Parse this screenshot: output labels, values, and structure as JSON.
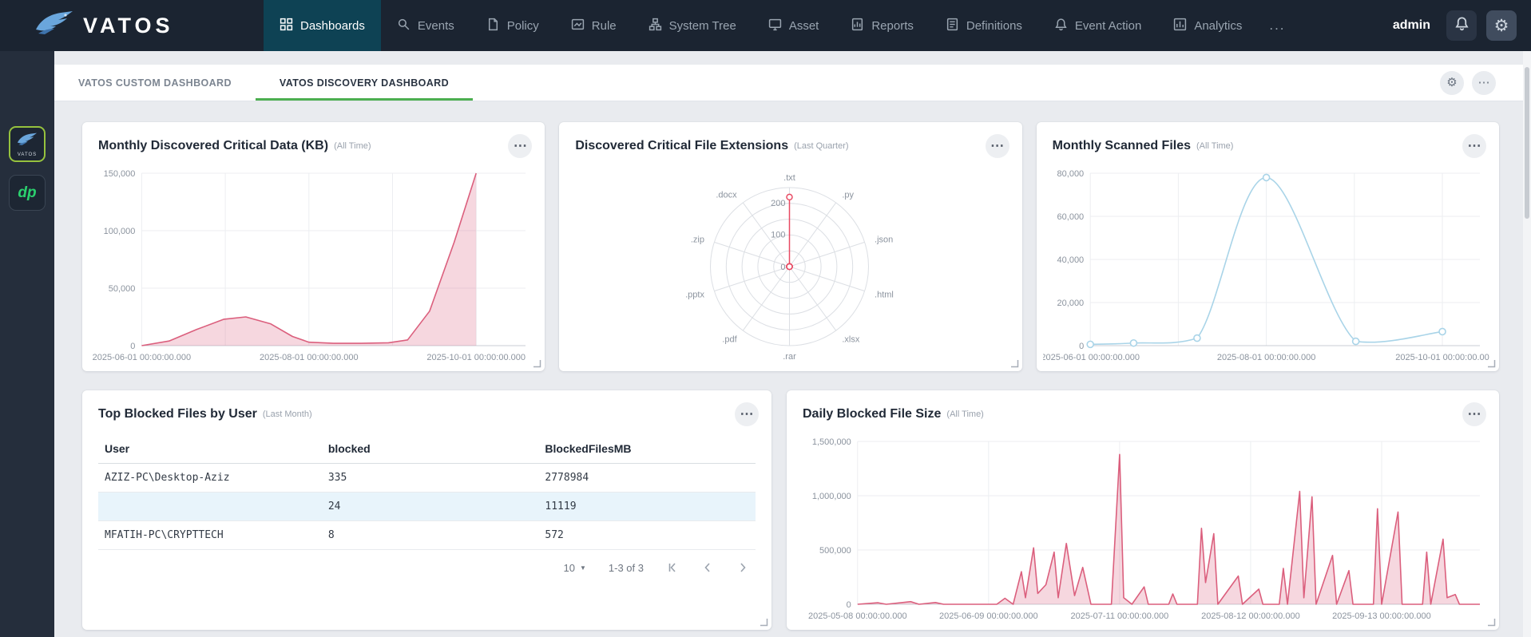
{
  "topbar": {
    "user": "admin"
  },
  "brand": {
    "name": "VATOS"
  },
  "icons": {
    "gear": "⚙",
    "more": "⋯",
    "caret": "▼"
  },
  "nav": {
    "items": [
      {
        "label": "Dashboards"
      },
      {
        "label": "Events"
      },
      {
        "label": "Policy"
      },
      {
        "label": "Rule"
      },
      {
        "label": "System Tree"
      },
      {
        "label": "Asset"
      },
      {
        "label": "Reports"
      },
      {
        "label": "Definitions"
      },
      {
        "label": "Event Action"
      },
      {
        "label": "Analytics"
      },
      {
        "label": "..."
      }
    ]
  },
  "sidebar": {
    "items": [
      {
        "name": "vatos-app",
        "text": "VATOS"
      },
      {
        "name": "cryptech-app",
        "text": "dp"
      }
    ]
  },
  "tabs": [
    {
      "label": "VATOS CUSTOM DASHBOARD",
      "active": false
    },
    {
      "label": "VATOS DISCOVERY DASHBOARD",
      "active": true
    }
  ],
  "cards": {
    "critical_data": {
      "title": "Monthly Discovered Critical Data (KB)",
      "subtitle": "(All Time)"
    },
    "extensions": {
      "title": "Discovered Critical File Extensions",
      "subtitle": "(Last Quarter)"
    },
    "scanned": {
      "title": "Monthly Scanned Files",
      "subtitle": "(All Time)"
    },
    "top_blocked": {
      "title": "Top Blocked Files by User",
      "subtitle": "(Last Month)",
      "columns": [
        "User",
        "blocked",
        "BlockedFilesMB"
      ],
      "rows": [
        {
          "user": "AZIZ-PC\\Desktop-Aziz",
          "blocked": "335",
          "mb": "2778984"
        },
        {
          "user": "",
          "blocked": "24",
          "mb": "11119"
        },
        {
          "user": "MFATIH-PC\\CRYPTTECH",
          "blocked": "8",
          "mb": "572"
        }
      ],
      "pagination": {
        "page_size": "10",
        "range": "1-3 of 3"
      }
    },
    "daily_blocked": {
      "title": "Daily Blocked File Size",
      "subtitle": "(All Time)"
    }
  },
  "chart_data": [
    {
      "id": "critical-data",
      "type": "area",
      "title": "Monthly Discovered Critical Data (KB)",
      "period": "All Time",
      "x_domain": [
        0,
        140
      ],
      "x_grid": [
        0,
        30.5,
        61,
        91.5,
        122
      ],
      "x_ticks": [
        {
          "d": 0,
          "label": "2025-06-01 00:00:00.000"
        },
        {
          "d": 61,
          "label": "2025-08-01 00:00:00.000"
        },
        {
          "d": 122,
          "label": "2025-10-01 00:00:00.000"
        }
      ],
      "y_ticks": [
        0,
        50000,
        100000,
        150000
      ],
      "y_max": 150000,
      "line_color": "#db5f7d",
      "fill_color": "rgba(224,112,139,0.28)",
      "smooth": false,
      "markers": false,
      "points": [
        [
          0,
          0
        ],
        [
          10,
          4000
        ],
        [
          20,
          14000
        ],
        [
          30,
          23000
        ],
        [
          38,
          25000
        ],
        [
          47,
          19000
        ],
        [
          55,
          8000
        ],
        [
          61,
          3000
        ],
        [
          70,
          2000
        ],
        [
          80,
          2000
        ],
        [
          90,
          2500
        ],
        [
          97,
          5000
        ],
        [
          105,
          30000
        ],
        [
          114,
          90000
        ],
        [
          122,
          150000
        ]
      ]
    },
    {
      "id": "extensions",
      "type": "radar",
      "title": "Discovered Critical File Extensions",
      "period": "Last Quarter",
      "labels": [
        ".txt",
        ".py",
        ".json",
        ".html",
        ".xlsx",
        ".rar",
        ".pdf",
        ".pptx",
        ".zip",
        ".docx"
      ],
      "values": [
        220,
        0,
        0,
        0,
        0,
        0,
        0,
        0,
        0,
        0
      ],
      "max": 250,
      "rings": [
        50,
        100,
        150,
        200,
        250
      ],
      "ring_labels": [
        0,
        100,
        200
      ],
      "line_color": "#e84a63",
      "fill_color": "rgba(232,74,99,0.15)"
    },
    {
      "id": "scanned",
      "type": "line",
      "title": "Monthly Scanned Files",
      "period": "All Time",
      "x_domain": [
        0,
        135
      ],
      "x_grid": [
        0,
        30.5,
        61,
        91.5,
        122
      ],
      "x_ticks": [
        {
          "d": 0,
          "label": "2025-06-01 00:00:00.000"
        },
        {
          "d": 61,
          "label": "2025-08-01 00:00:00.000"
        },
        {
          "d": 122,
          "label": "2025-10-01 00:00:00.00"
        }
      ],
      "y_ticks": [
        0,
        20000,
        40000,
        60000,
        80000
      ],
      "y_max": 80000,
      "line_color": "#a9d4e8",
      "fill_color": null,
      "smooth": true,
      "markers": true,
      "points": [
        [
          0,
          600
        ],
        [
          15,
          1200
        ],
        [
          37,
          3500
        ],
        [
          61,
          78000
        ],
        [
          92,
          2000
        ],
        [
          122,
          6500
        ]
      ]
    },
    {
      "id": "daily-blocked",
      "type": "area",
      "title": "Daily Blocked File Size",
      "period": "All Time",
      "x_domain": [
        0,
        152
      ],
      "x_grid": [
        0,
        32,
        64,
        96,
        128
      ],
      "x_ticks": [
        {
          "d": 0,
          "label": "2025-05-08 00:00:00.000"
        },
        {
          "d": 32,
          "label": "2025-06-09 00:00:00.000"
        },
        {
          "d": 64,
          "label": "2025-07-11 00:00:00.000"
        },
        {
          "d": 96,
          "label": "2025-08-12 00:00:00.000"
        },
        {
          "d": 128,
          "label": "2025-09-13 00:00:00.000"
        }
      ],
      "y_ticks": [
        0,
        500000,
        1000000,
        1500000
      ],
      "y_max": 1500000,
      "line_color": "#db5f7d",
      "fill_color": "rgba(224,112,139,0.28)",
      "smooth": false,
      "markers": false,
      "points": [
        [
          0,
          0
        ],
        [
          5,
          14000
        ],
        [
          7,
          0
        ],
        [
          13,
          24000
        ],
        [
          15,
          0
        ],
        [
          19,
          16000
        ],
        [
          21,
          0
        ],
        [
          34,
          0
        ],
        [
          36,
          55000
        ],
        [
          38,
          0
        ],
        [
          40,
          300000
        ],
        [
          41,
          60000
        ],
        [
          43,
          520000
        ],
        [
          44,
          100000
        ],
        [
          46,
          180000
        ],
        [
          48,
          480000
        ],
        [
          49,
          60000
        ],
        [
          51,
          560000
        ],
        [
          53,
          80000
        ],
        [
          55,
          340000
        ],
        [
          57,
          0
        ],
        [
          62,
          0
        ],
        [
          64,
          1380000
        ],
        [
          65,
          60000
        ],
        [
          67,
          0
        ],
        [
          70,
          160000
        ],
        [
          71,
          0
        ],
        [
          76,
          0
        ],
        [
          77,
          95000
        ],
        [
          78,
          0
        ],
        [
          83,
          0
        ],
        [
          84,
          700000
        ],
        [
          85,
          200000
        ],
        [
          87,
          650000
        ],
        [
          88,
          0
        ],
        [
          93,
          260000
        ],
        [
          94,
          0
        ],
        [
          98,
          140000
        ],
        [
          99,
          0
        ],
        [
          103,
          0
        ],
        [
          104,
          330000
        ],
        [
          105,
          0
        ],
        [
          108,
          1040000
        ],
        [
          109,
          60000
        ],
        [
          111,
          990000
        ],
        [
          112,
          0
        ],
        [
          116,
          450000
        ],
        [
          117,
          0
        ],
        [
          120,
          310000
        ],
        [
          121,
          0
        ],
        [
          126,
          0
        ],
        [
          127,
          880000
        ],
        [
          128,
          0
        ],
        [
          132,
          850000
        ],
        [
          133,
          0
        ],
        [
          138,
          0
        ],
        [
          139,
          480000
        ],
        [
          140,
          0
        ],
        [
          143,
          600000
        ],
        [
          144,
          60000
        ],
        [
          146,
          90000
        ],
        [
          147,
          0
        ],
        [
          152,
          0
        ]
      ]
    }
  ]
}
